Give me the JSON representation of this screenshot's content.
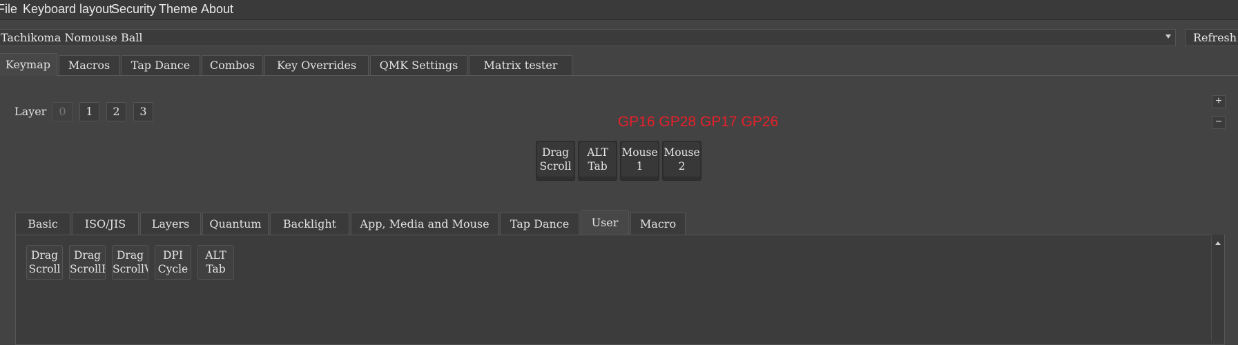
{
  "menu": [
    "File",
    "Keyboard layout",
    "Security",
    "Theme",
    "About"
  ],
  "device": {
    "selected": "Tachikoma Nomouse Ball",
    "refresh_label": "Refresh"
  },
  "main_tabs": [
    "Keymap",
    "Macros",
    "Tap Dance",
    "Combos",
    "Key Overrides",
    "QMK Settings",
    "Matrix tester"
  ],
  "main_tabs_active": "Keymap",
  "layer": {
    "label": "Layer",
    "buttons": [
      "0",
      "1",
      "2",
      "3"
    ],
    "selected": "0"
  },
  "zoom": {
    "in": "+",
    "out": "−"
  },
  "pins_label": "GP16 GP28 GP17 GP26",
  "pin_label_color": "#e8202a",
  "keys": [
    {
      "line1": "Drag",
      "line2": "Scroll"
    },
    {
      "line1": "ALT",
      "line2": "Tab"
    },
    {
      "line1": "Mouse",
      "line2": "1"
    },
    {
      "line1": "Mouse",
      "line2": "2"
    }
  ],
  "keycode_tabs": [
    "Basic",
    "ISO/JIS",
    "Layers",
    "Quantum",
    "Backlight",
    "App, Media and Mouse",
    "Tap Dance",
    "User",
    "Macro"
  ],
  "keycode_tabs_active": "User",
  "user_keys": [
    {
      "line1": "Drag",
      "line2": "Scroll"
    },
    {
      "line1": "Drag",
      "line2": "ScrollH"
    },
    {
      "line1": "Drag",
      "line2": "ScrollV"
    },
    {
      "line1": "DPI",
      "line2": "Cycle"
    },
    {
      "line1": "ALT",
      "line2": "Tab"
    }
  ],
  "icons": {
    "dropdown": "chevron-down-icon",
    "scroll_up": "arrow-up-icon"
  }
}
